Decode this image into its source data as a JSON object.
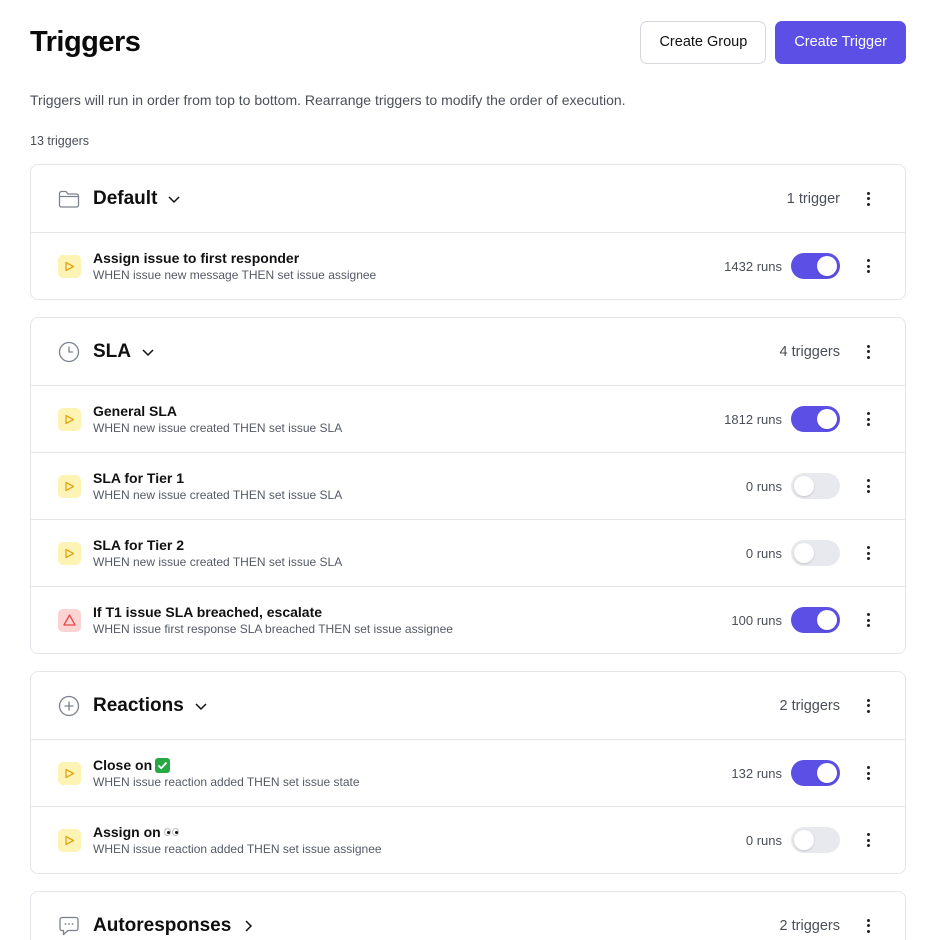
{
  "header": {
    "title": "Triggers",
    "create_group": "Create Group",
    "create_trigger": "Create Trigger"
  },
  "subtitle": "Triggers will run in order from top to bottom. Rearrange triggers to modify the order of execution.",
  "count": "13 triggers",
  "colors": {
    "accent": "#5b4fe6",
    "play_badge": "#fdf3b4",
    "warn_badge": "#fcd3d3"
  },
  "groups": [
    {
      "name": "Default",
      "icon": "folder-icon",
      "expanded": true,
      "count": "1 trigger",
      "triggers": [
        {
          "name": "Assign issue to first responder",
          "desc": "WHEN issue new message THEN set issue assignee",
          "runs": "1432 runs",
          "enabled": true,
          "icon": "play-icon"
        }
      ]
    },
    {
      "name": "SLA",
      "icon": "clock-icon",
      "expanded": true,
      "count": "4 triggers",
      "triggers": [
        {
          "name": "General SLA",
          "desc": "WHEN new issue created THEN set issue SLA",
          "runs": "1812 runs",
          "enabled": true,
          "icon": "play-icon"
        },
        {
          "name": "SLA for Tier 1",
          "desc": "WHEN new issue created THEN set issue SLA",
          "runs": "0 runs",
          "enabled": false,
          "icon": "play-icon"
        },
        {
          "name": "SLA for Tier 2",
          "desc": "WHEN new issue created THEN set issue SLA",
          "runs": "0 runs",
          "enabled": false,
          "icon": "play-icon"
        },
        {
          "name": "If T1 issue SLA breached, escalate",
          "desc": "WHEN issue first response SLA breached THEN set issue assignee",
          "runs": "100 runs",
          "enabled": true,
          "icon": "warning-icon"
        }
      ]
    },
    {
      "name": "Reactions",
      "icon": "plus-circle-icon",
      "expanded": true,
      "count": "2 triggers",
      "triggers": [
        {
          "name": "Close on",
          "emoji": "check-mark-emoji",
          "desc": "WHEN issue reaction added THEN set issue state",
          "runs": "132 runs",
          "enabled": true,
          "icon": "play-icon"
        },
        {
          "name": "Assign on",
          "emoji": "eyes-emoji",
          "desc": "WHEN issue reaction added THEN set issue assignee",
          "runs": "0 runs",
          "enabled": false,
          "icon": "play-icon"
        }
      ]
    },
    {
      "name": "Autoresponses",
      "icon": "chat-bubble-icon",
      "expanded": false,
      "count": "2 triggers",
      "triggers": []
    }
  ]
}
